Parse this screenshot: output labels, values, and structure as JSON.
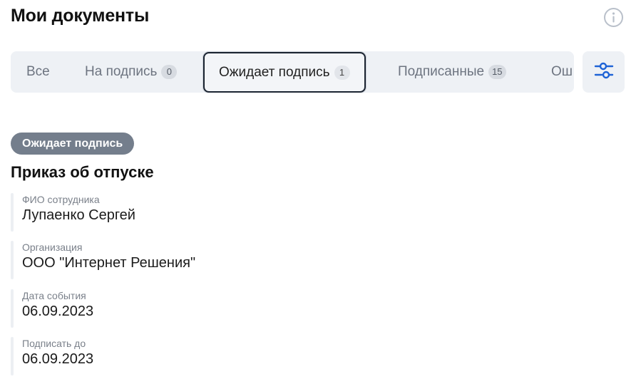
{
  "header": {
    "title": "Мои документы",
    "info_icon": "info-icon"
  },
  "tabs": [
    {
      "label": "Все",
      "count": null,
      "active": false
    },
    {
      "label": "На подпись",
      "count": "0",
      "active": false
    },
    {
      "label": "Ожидает подпись",
      "count": "1",
      "active": true
    },
    {
      "label": "Подписанные",
      "count": "15",
      "active": false
    },
    {
      "label": "Ош",
      "count": null,
      "active": false
    }
  ],
  "filter_button": {
    "icon": "filter-sliders-icon",
    "color": "#1e63d6"
  },
  "document": {
    "status": "Ожидает подпись",
    "title": "Приказ об отпуске",
    "fields": [
      {
        "label": "ФИО сотрудника",
        "value": "Лупаенко Сергей"
      },
      {
        "label": "Организация",
        "value": "ООО \"Интернет Решения\""
      },
      {
        "label": "Дата события",
        "value": "06.09.2023"
      },
      {
        "label": "Подписать до",
        "value": "06.09.2023"
      }
    ]
  },
  "colors": {
    "status_pill": "#747e8c",
    "tab_bar": "#eef1f5",
    "accent": "#1e63d6"
  }
}
